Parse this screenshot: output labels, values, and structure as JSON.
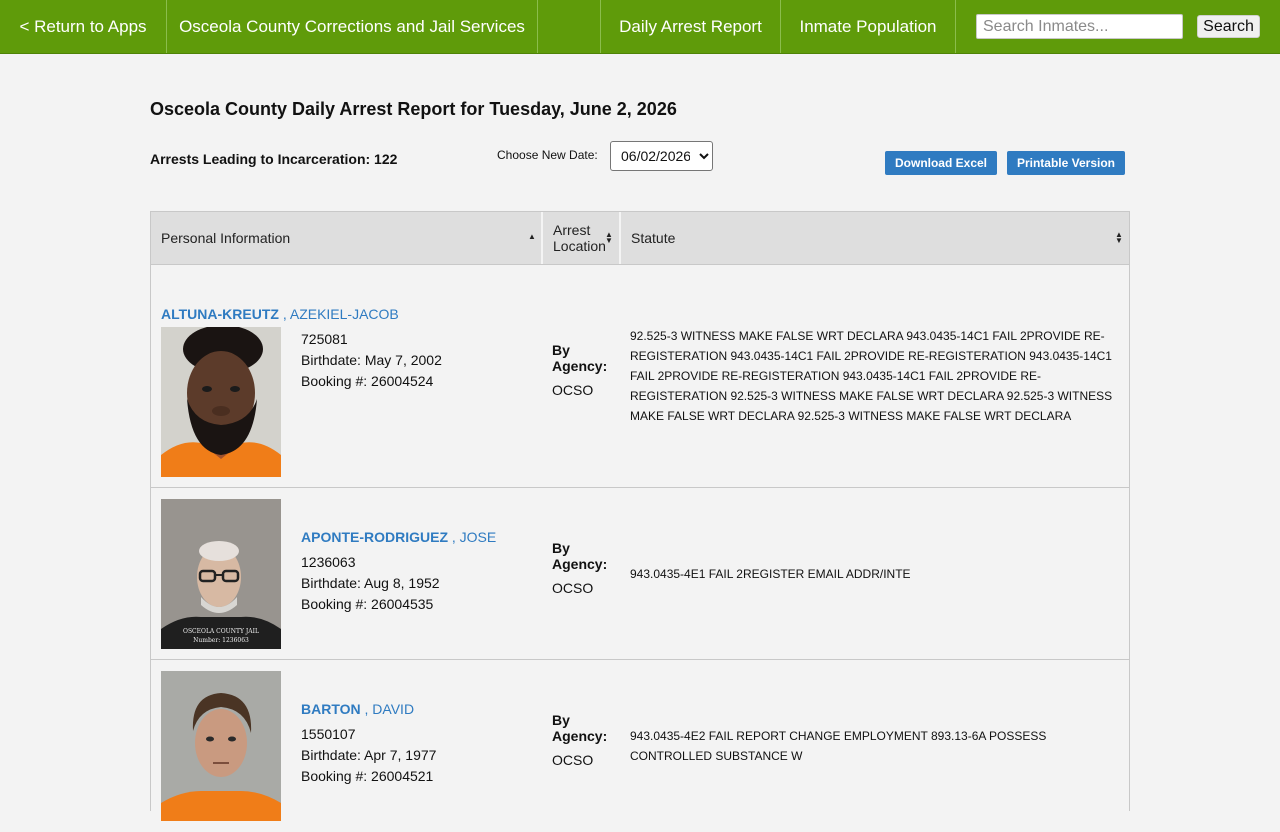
{
  "nav": {
    "return_label": "< Return to Apps",
    "site_title": "Osceola County Corrections and Jail Services",
    "daily_report_label": "Daily Arrest Report",
    "inmate_population_label": "Inmate Population",
    "search_placeholder": "Search Inmates...",
    "search_button": "Search"
  },
  "header": {
    "title": "Osceola County Daily Arrest Report for Tuesday, June 2, 2026",
    "arrests_count": "Arrests Leading to Incarceration: 122",
    "date_label": "Choose New Date:",
    "selected_date": "06/02/2026",
    "download_excel": "Download Excel",
    "printable_version": "Printable Version"
  },
  "table": {
    "columns": [
      "Personal Information",
      "Arrest Location",
      "Statute"
    ],
    "rows": [
      {
        "last_name": "ALTUNA-KREUTZ",
        "first_name": ", AZEKIEL-JACOB",
        "id": "725081",
        "birthdate": "Birthdate: May 7, 2002",
        "booking": "Booking #: 26004524",
        "agency_label": "By Agency:",
        "agency": "OCSO",
        "statute": "92.525-3 WITNESS MAKE FALSE WRT DECLARA 943.0435-14C1 FAIL 2PROVIDE RE-REGISTERATION 943.0435-14C1 FAIL 2PROVIDE RE-REGISTERATION 943.0435-14C1 FAIL 2PROVIDE RE-REGISTERATION 943.0435-14C1 FAIL 2PROVIDE RE-REGISTERATION 92.525-3 WITNESS MAKE FALSE WRT DECLARA 92.525-3 WITNESS MAKE FALSE WRT DECLARA 92.525-3 WITNESS MAKE FALSE WRT DECLARA"
      },
      {
        "last_name": "APONTE-RODRIGUEZ",
        "first_name": ", JOSE",
        "id": "1236063",
        "birthdate": "Birthdate: Aug 8, 1952",
        "booking": "Booking #: 26004535",
        "agency_label": "By Agency:",
        "agency": "OCSO",
        "statute": "943.0435-4E1 FAIL 2REGISTER EMAIL ADDR/INTE",
        "photo_caption_1": "OSCEOLA COUNTY JAIL",
        "photo_caption_2": "Number: 1236063"
      },
      {
        "last_name": "BARTON",
        "first_name": ", DAVID",
        "id": "1550107",
        "birthdate": "Birthdate: Apr 7, 1977",
        "booking": "Booking #: 26004521",
        "agency_label": "By Agency:",
        "agency": "OCSO",
        "statute": "943.0435-4E2 FAIL REPORT CHANGE EMPLOYMENT 893.13-6A POSSESS CONTROLLED SUBSTANCE W"
      }
    ]
  },
  "colors": {
    "nav_green": "#5f9b0a",
    "link_blue": "#2f7bc1",
    "button_blue": "#2f7bc1",
    "page_bg": "#f3f3f3"
  }
}
